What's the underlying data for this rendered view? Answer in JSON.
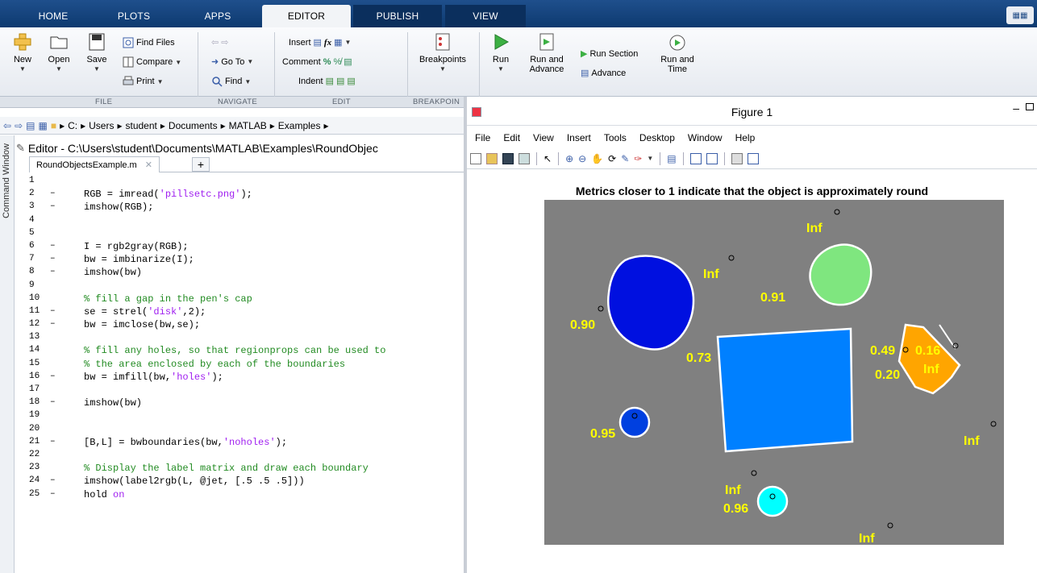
{
  "tabs": [
    {
      "label": "HOME"
    },
    {
      "label": "PLOTS"
    },
    {
      "label": "APPS"
    },
    {
      "label": "EDITOR"
    },
    {
      "label": "PUBLISH"
    },
    {
      "label": "VIEW"
    }
  ],
  "ribbon": {
    "new": "New",
    "open": "Open",
    "save": "Save",
    "find_files": "Find Files",
    "compare": "Compare",
    "print": "Print",
    "go_to": "Go To",
    "find": "Find",
    "insert": "Insert",
    "comment": "Comment",
    "indent": "Indent",
    "breakpoints": "Breakpoints",
    "run": "Run",
    "run_and_advance_1": "Run and",
    "run_and_advance_2": "Advance",
    "run_section": "Run Section",
    "advance": "Advance",
    "run_and_time_1": "Run and",
    "run_and_time_2": "Time",
    "groups": [
      "FILE",
      "NAVIGATE",
      "EDIT",
      "BREAKPOIN"
    ]
  },
  "address": {
    "crumbs": [
      "C:",
      "Users",
      "student",
      "Documents",
      "MATLAB",
      "Examples"
    ]
  },
  "command_window_label": "Command Window",
  "editor": {
    "title": "Editor - C:\\Users\\student\\Documents\\MATLAB\\Examples\\RoundObjec",
    "file_tab": "RoundObjectsExample.m",
    "lines": [
      {
        "n": "1",
        "dash": "",
        "code": ""
      },
      {
        "n": "2",
        "dash": "–",
        "code": "RGB = imread(",
        "str": "'pillsetc.png'",
        "after": ");"
      },
      {
        "n": "3",
        "dash": "–",
        "code": "imshow(RGB);"
      },
      {
        "n": "4",
        "dash": "",
        "code": ""
      },
      {
        "n": "5",
        "dash": "",
        "code": ""
      },
      {
        "n": "6",
        "dash": "–",
        "code": "I = rgb2gray(RGB);"
      },
      {
        "n": "7",
        "dash": "–",
        "code": "bw = imbinarize(I);"
      },
      {
        "n": "8",
        "dash": "–",
        "code": "imshow(bw)"
      },
      {
        "n": "9",
        "dash": "",
        "code": ""
      },
      {
        "n": "10",
        "dash": "",
        "cmt": "% fill a gap in the pen's cap"
      },
      {
        "n": "11",
        "dash": "–",
        "code": "se = strel(",
        "str": "'disk'",
        "after": ",2);"
      },
      {
        "n": "12",
        "dash": "–",
        "code": "bw = imclose(bw,se);"
      },
      {
        "n": "13",
        "dash": "",
        "code": ""
      },
      {
        "n": "14",
        "dash": "",
        "cmt": "% fill any holes, so that regionprops can be used to"
      },
      {
        "n": "15",
        "dash": "",
        "cmt": "% the area enclosed by each of the boundaries"
      },
      {
        "n": "16",
        "dash": "–",
        "code": "bw = imfill(bw,",
        "str": "'holes'",
        "after": ");"
      },
      {
        "n": "17",
        "dash": "",
        "code": ""
      },
      {
        "n": "18",
        "dash": "–",
        "code": "imshow(bw)"
      },
      {
        "n": "19",
        "dash": "",
        "code": ""
      },
      {
        "n": "20",
        "dash": "",
        "code": ""
      },
      {
        "n": "21",
        "dash": "–",
        "code": "[B,L] = bwboundaries(bw,",
        "str": "'noholes'",
        "after": ");"
      },
      {
        "n": "22",
        "dash": "",
        "code": ""
      },
      {
        "n": "23",
        "dash": "",
        "cmt": "% Display the label matrix and draw each boundary"
      },
      {
        "n": "24",
        "dash": "–",
        "code": "imshow(label2rgb(L, @jet, [.5 .5 .5]))"
      },
      {
        "n": "25",
        "dash": "–",
        "code": "hold ",
        "str": "on",
        "after": ""
      }
    ]
  },
  "figure": {
    "window_title": "Figure 1",
    "menu": [
      "File",
      "Edit",
      "View",
      "Insert",
      "Tools",
      "Desktop",
      "Window",
      "Help"
    ],
    "plot_title": "Metrics closer to 1 indicate that the object is approximately round",
    "labels": [
      "Inf",
      "Inf",
      "0.91",
      "0.90",
      "0.73",
      "0.49",
      "0.16",
      "Inf",
      "0.20",
      "0.95",
      "Inf",
      "Inf",
      "0.96",
      "Inf"
    ],
    "colors": {
      "bg": "#808080",
      "label": "#ffff00",
      "boundary": "#ffffff"
    }
  }
}
